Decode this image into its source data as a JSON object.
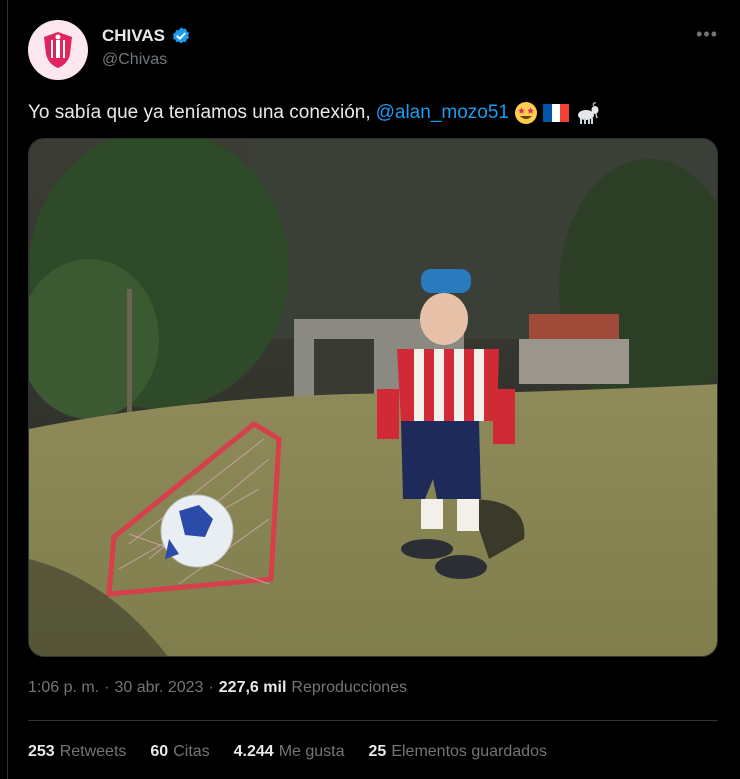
{
  "account": {
    "name": "CHIVAS",
    "handle": "@Chivas",
    "verified_color": "#1d9bf0",
    "avatar_icon": "chivas-crest-icon"
  },
  "tweet": {
    "text": "Yo sabía que ya teníamos una conexión,",
    "mention": "@alan_mozo51",
    "emojis": [
      "star-struck-emoji",
      "france-flag-emoji",
      "goat-emoji"
    ]
  },
  "meta": {
    "time": "1:06 p. m.",
    "separator": "·",
    "date": "30 abr. 2023",
    "views_count": "227,6 mil",
    "views_label": "Reproducciones"
  },
  "stats": {
    "retweets_count": "253",
    "retweets_label": "Retweets",
    "quotes_count": "60",
    "quotes_label": "Citas",
    "likes_count": "4.244",
    "likes_label": "Me gusta",
    "bookmarks_count": "25",
    "bookmarks_label": "Elementos guardados"
  },
  "colors": {
    "accent": "#1d9bf0",
    "muted": "#71767b",
    "text": "#e7e9ea"
  }
}
